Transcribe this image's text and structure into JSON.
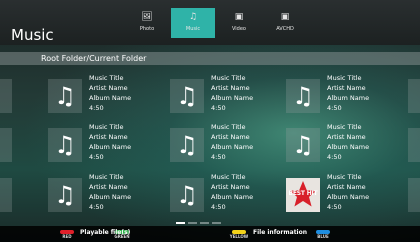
{
  "app": {
    "title": "Music"
  },
  "tabs": [
    {
      "label": "Photo",
      "icon": "photo-icon",
      "glyph": "🖼",
      "active": false
    },
    {
      "label": "Music",
      "icon": "music-note-icon",
      "glyph": "♫",
      "active": true
    },
    {
      "label": "Video",
      "icon": "video-icon",
      "glyph": "▣",
      "active": false
    },
    {
      "label": "AVCHD",
      "icon": "avchd-icon",
      "glyph": "▣",
      "active": false
    }
  ],
  "breadcrumb": {
    "path": "Root Folder/Current Folder"
  },
  "items": [
    {
      "title": "Music Title",
      "artist": "Artist Name",
      "album": "Album Name",
      "duration": "4:50",
      "art": "music-note-icon"
    },
    {
      "title": "Music Title",
      "artist": "Artist Name",
      "album": "Album Name",
      "duration": "4:50",
      "art": "music-note-icon"
    },
    {
      "title": "Music Title",
      "artist": "Artist Name",
      "album": "Album Name",
      "duration": "4:50",
      "art": "music-note-icon"
    },
    {
      "title": "Music Title",
      "artist": "Artist Name",
      "album": "Album Name",
      "duration": "4:50",
      "art": "music-note-icon"
    },
    {
      "title": "Music Title",
      "artist": "Artist Name",
      "album": "Album Name",
      "duration": "4:50",
      "art": "music-note-icon"
    },
    {
      "title": "Music Title",
      "artist": "Artist Name",
      "album": "Album Name",
      "duration": "4:50",
      "art": "music-note-icon"
    },
    {
      "title": "Music Title",
      "artist": "Artist Name",
      "album": "Album Name",
      "duration": "4:50",
      "art": "music-note-icon"
    },
    {
      "title": "Music Title",
      "artist": "Artist Name",
      "album": "Album Name",
      "duration": "4:50",
      "art": "music-note-icon"
    },
    {
      "title": "Music Title",
      "artist": "Artist Name",
      "album": "Album Name",
      "duration": "4:50",
      "art": "best-hit-album-art",
      "art_text": "BEST HIT"
    }
  ],
  "pagination": {
    "pages": 4,
    "current": 1
  },
  "footer": {
    "keys": [
      {
        "label": "RED",
        "color": "#e0202a"
      },
      {
        "label": "GREEN",
        "color": "#2fb04a"
      },
      {
        "label": "YELLOW",
        "color": "#f2d21b"
      },
      {
        "label": "BLUE",
        "color": "#1f8ee0"
      }
    ],
    "hint_green": "Playable file(s)",
    "hint_blue": "File information"
  },
  "colors": {
    "accent": "#2fb3a8"
  }
}
